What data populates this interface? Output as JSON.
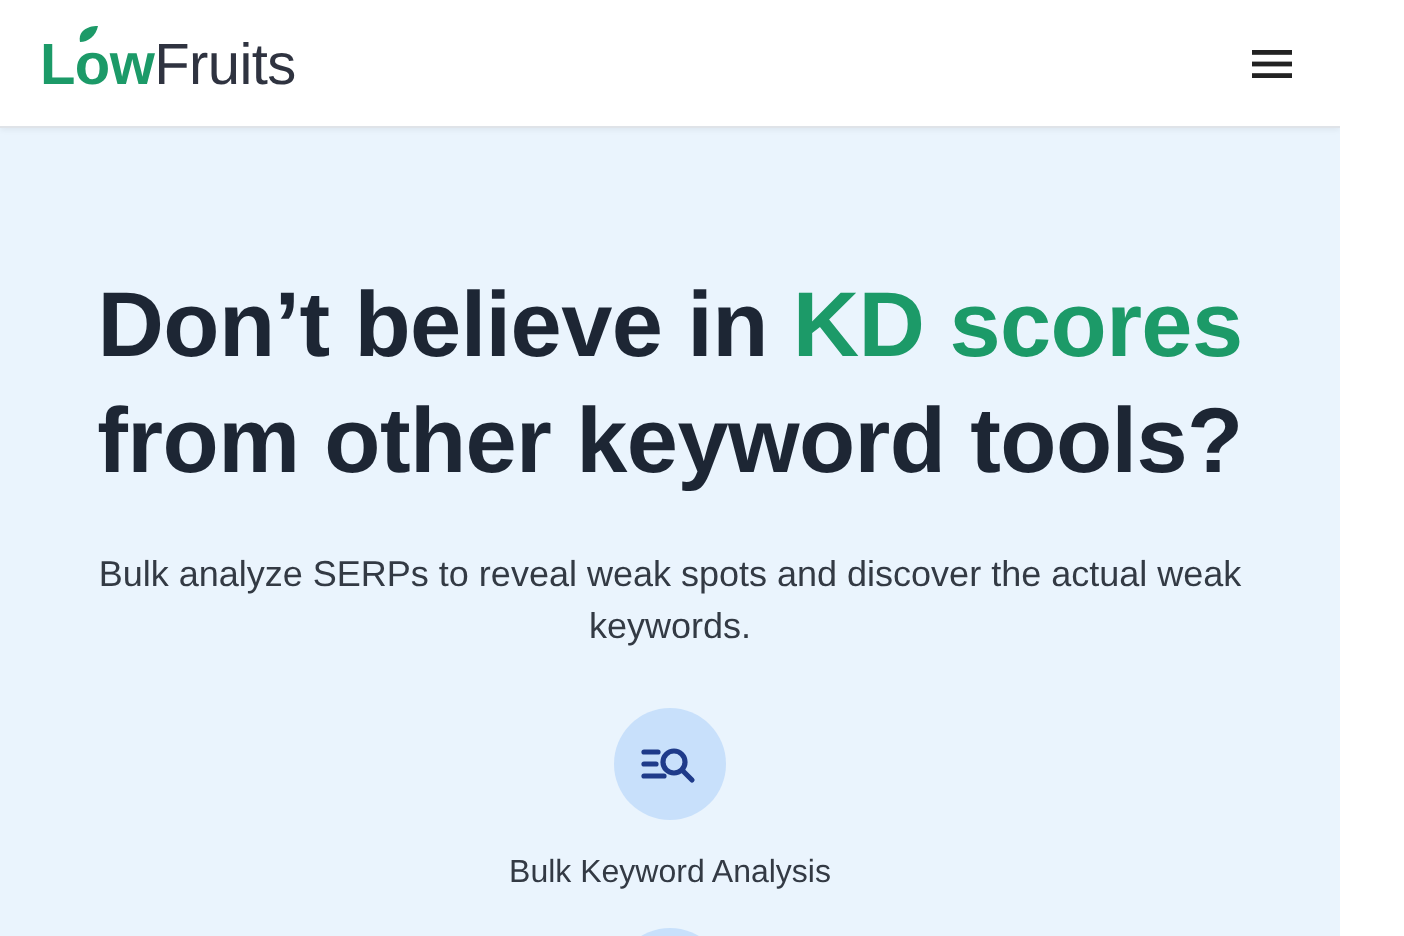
{
  "header": {
    "logo": {
      "accent": "Low",
      "rest": "Fruits"
    }
  },
  "hero": {
    "headline": [
      {
        "text": "Don’t believe in ",
        "highlight": false
      },
      {
        "text": "KD scores",
        "highlight": true
      },
      {
        "text": " from other keyword tools?",
        "highlight": false
      }
    ],
    "subtitle": "Bulk analyze SERPs to reveal weak spots and discover the actual weak keywords.",
    "features": [
      {
        "kind": "search-list",
        "label": "Bulk Keyword Analysis"
      },
      {
        "kind": "cut-off"
      }
    ]
  }
}
